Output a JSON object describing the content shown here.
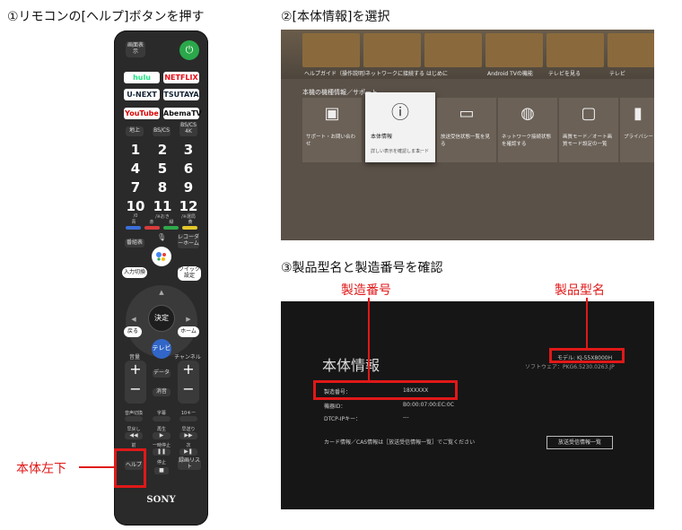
{
  "steps": {
    "step1": "①リモコンの[ヘルプ]ボタンを押す",
    "step2": "②[本体情報]を選択",
    "step3": "③製品型名と製造番号を確認"
  },
  "annotations": {
    "remote_bottom_left": "本体左下",
    "serial_label": "製造番号",
    "model_label": "製品型名"
  },
  "remote": {
    "screen_display": "画面表示",
    "services": [
      "hulu",
      "NETFLIX",
      "U-NEXT",
      "TSUTAYA",
      "YouTube",
      "AbemaTV"
    ],
    "tuners": [
      "地上",
      "BS/CS",
      "BS/CS 4K"
    ],
    "numbers": [
      "1",
      "2",
      "3",
      "4",
      "5",
      "6",
      "7",
      "8",
      "9",
      "10",
      "11",
      "12"
    ],
    "num_subs": [
      "/0",
      "/※おき",
      "/※選局"
    ],
    "colors": [
      "青",
      "赤",
      "緑",
      "黄"
    ],
    "color_hex": [
      "#3b6fd8",
      "#d83b3b",
      "#2fa84a",
      "#e3c72a"
    ],
    "program_guide": "番組表",
    "recorder_home": "レコーダーホーム",
    "input": "入力切換",
    "quick": "クイック設定",
    "enter": "決定",
    "back": "戻る",
    "home": "ホーム",
    "tv": "テレビ",
    "volume": "音量",
    "channel": "チャンネル",
    "data": "データ",
    "mute": "消音",
    "audio": "音声切換",
    "subtitle": "字幕",
    "ten_key": "10キー",
    "rewind": "早戻し",
    "play": "再生",
    "ffwd": "早送り",
    "prev": "前",
    "pause": "一時停止",
    "next": "次",
    "help": "ヘルプ",
    "stop": "停止",
    "rec_list": "録画リスト",
    "brand": "SONY"
  },
  "screen1": {
    "top_labels": [
      "ヘルプガイド（操作説明）",
      "ネットワークに接続する",
      "はじめに",
      "Android TVの機能",
      "テレビを見る",
      "テレビ"
    ],
    "section": "本機の機種情報／サポート",
    "cards": [
      {
        "icon": "support-icon",
        "label": "サポート・お問い合わせ"
      },
      {
        "icon": "info-icon",
        "label": "本体情報",
        "sub": "詳しい表示を確認します。",
        "extra": "カード"
      },
      {
        "icon": "tv-signal-icon",
        "label": "放送受信状態一覧を見る"
      },
      {
        "icon": "globe-icon",
        "label": "ネットワーク接続状態を確認する"
      },
      {
        "icon": "picture-mode-icon",
        "label": "画質モード／オート画質モード設定の一覧"
      },
      {
        "icon": "privacy-icon",
        "label": "プライバシー"
      }
    ]
  },
  "screen2": {
    "title": "本体情報",
    "model_label": "モデル",
    "model_value": "KJ-55X8000H",
    "software_label": "ソフトウェア",
    "software_value": "PKG6.5230.0263.JP",
    "rows": [
      {
        "label": "製造番号：",
        "value": "18XXXXX"
      },
      {
        "label": "機器ID：",
        "value": "B0:00:07:00:EC:0C"
      },
      {
        "label": "DTCP-IPキー：",
        "value": "---"
      }
    ],
    "notice": "カード情報／CAS情報は［放送受信情報一覧］でご覧ください",
    "button": "放送受信情報一覧"
  }
}
